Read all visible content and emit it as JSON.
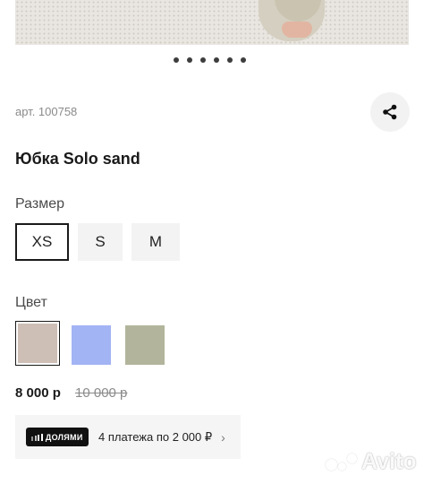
{
  "carousel": {
    "dot_count": 6
  },
  "product": {
    "article": "арт. 100758",
    "title": "Юбка Solo sand"
  },
  "share": {
    "icon": "share-icon"
  },
  "size_section": {
    "label": "Размер",
    "options": [
      "XS",
      "S",
      "M"
    ],
    "selected": "XS"
  },
  "color_section": {
    "label": "Цвет",
    "swatches": [
      "#cdbfb6",
      "#a3b4f4",
      "#b2b59b"
    ],
    "selected_index": 0
  },
  "pricing": {
    "price": "8 000 р",
    "old_price": "10 000 р"
  },
  "installment": {
    "badge": "ДОЛЯМИ",
    "text": "4 платежа по 2 000 ₽",
    "chevron": "›"
  },
  "watermark": {
    "text": "Avito"
  }
}
